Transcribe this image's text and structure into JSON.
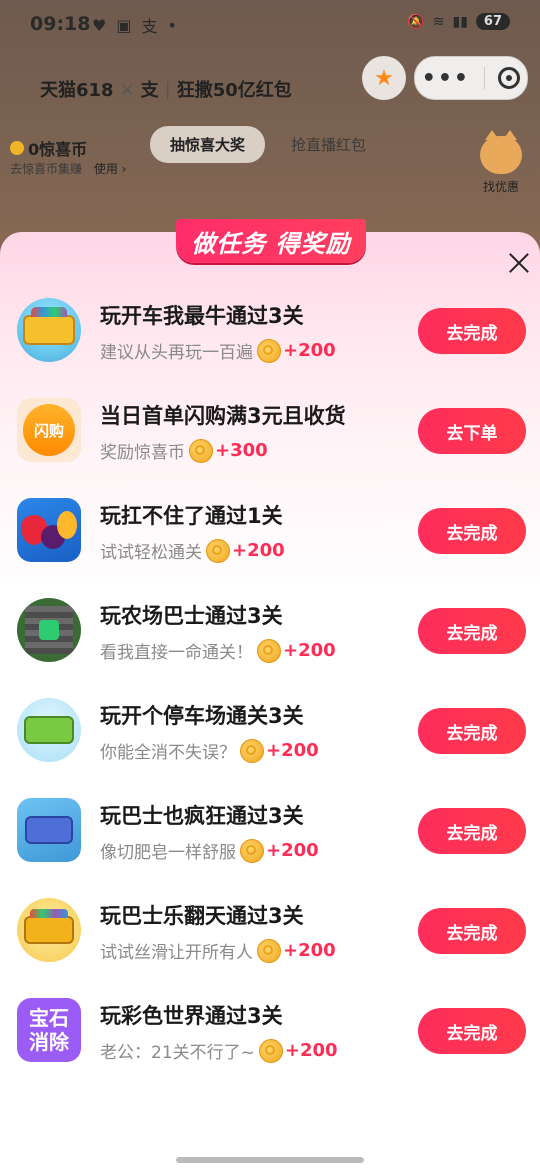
{
  "status": {
    "time": "09:18",
    "battery": "67"
  },
  "header": {
    "title_brand": "天猫618",
    "title_x": "×",
    "title_alipay": "支",
    "title_campaign": "狂撒50亿红包"
  },
  "sub": {
    "coins": "0惊喜币",
    "coins_hint": "去惊喜币集赚",
    "use": "使用 ›",
    "tabs": [
      "抽惊喜大奖",
      "抢直播红包"
    ],
    "deal_label": "找优惠"
  },
  "sheet": {
    "title": "做任务 得奖励",
    "tasks": [
      {
        "name": "玩开车我最牛通过3关",
        "desc": "建议从头再玩一百遍",
        "reward": "+200",
        "button": "去完成",
        "icon": "bus-game-icon"
      },
      {
        "name": "当日首单闪购满3元且收货",
        "desc": "奖励惊喜币",
        "reward": "+300",
        "button": "去下单",
        "icon": "flash-buy-icon",
        "icon_text": "闪购"
      },
      {
        "name": "玩扛不住了通过1关",
        "desc": "试试轻松通关",
        "reward": "+200",
        "button": "去完成",
        "icon": "fruit-game-icon"
      },
      {
        "name": "玩农场巴士通过3关",
        "desc": "看我直接一命通关！",
        "reward": "+200",
        "button": "去完成",
        "icon": "farm-bus-icon"
      },
      {
        "name": "玩开个停车场通关3关",
        "desc": "你能全消不失误？",
        "reward": "+200",
        "button": "去完成",
        "icon": "parking-game-icon"
      },
      {
        "name": "玩巴士也疯狂通过3关",
        "desc": "像切肥皂一样舒服",
        "reward": "+200",
        "button": "去完成",
        "icon": "crazy-bus-icon"
      },
      {
        "name": "玩巴士乐翻天通过3关",
        "desc": "试试丝滑让开所有人",
        "reward": "+200",
        "button": "去完成",
        "icon": "bus-fun-icon"
      },
      {
        "name": "玩彩色世界通过3关",
        "desc": "老公：21关不行了~",
        "reward": "+200",
        "button": "去完成",
        "icon": "gem-game-icon",
        "icon_text": "宝石消除"
      }
    ]
  }
}
